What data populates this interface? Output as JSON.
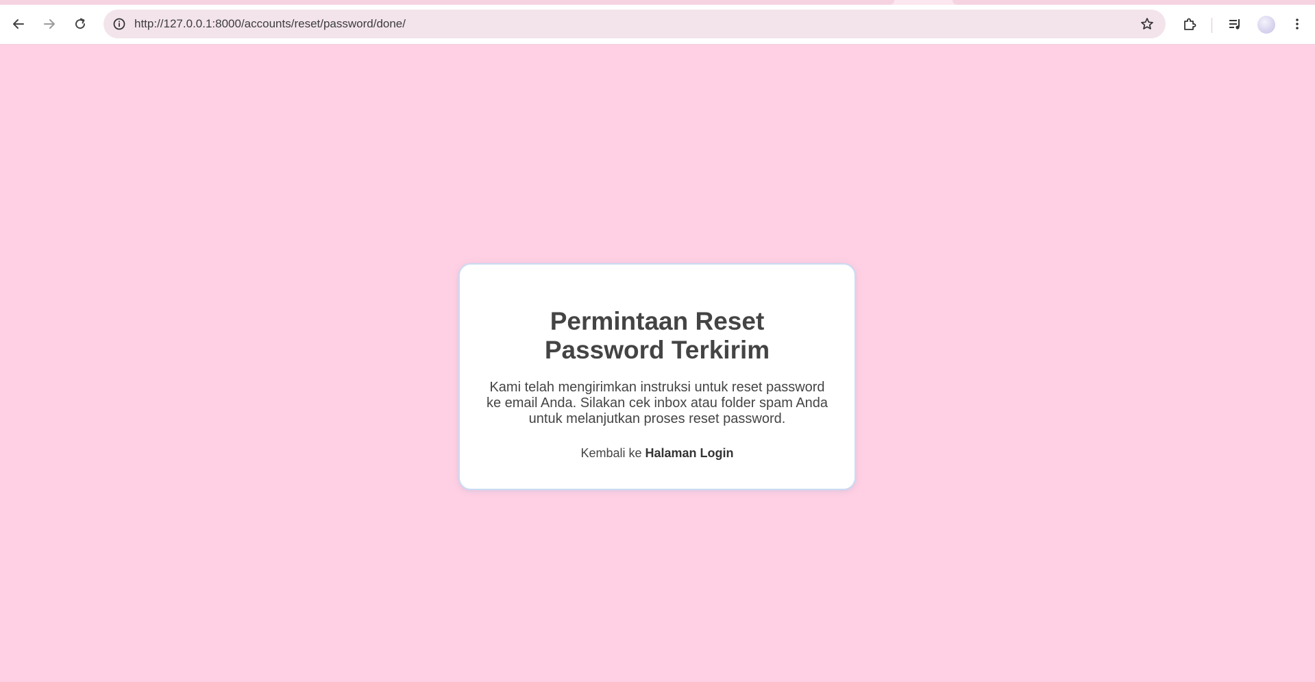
{
  "browser": {
    "url": "http://127.0.0.1:8000/accounts/reset/password/done/",
    "icons": [
      "back-arrow-icon",
      "forward-arrow-icon",
      "reload-icon",
      "site-info-icon",
      "bookmark-star-icon",
      "extensions-puzzle-icon",
      "media-queue-icon",
      "kebab-menu-icon"
    ]
  },
  "page": {
    "title": "Permintaan Reset Password Terkirim",
    "message": "Kami telah mengirimkan instruksi untuk reset password ke email Anda. Silakan cek inbox atau folder spam Anda untuk melanjutkan proses reset password.",
    "back_prefix": "Kembali ke",
    "back_link": "Halaman Login"
  },
  "colors": {
    "background": "#ffcfe3",
    "card": "#ffffff",
    "card_border": "#c9dcf4",
    "text": "#444444"
  }
}
